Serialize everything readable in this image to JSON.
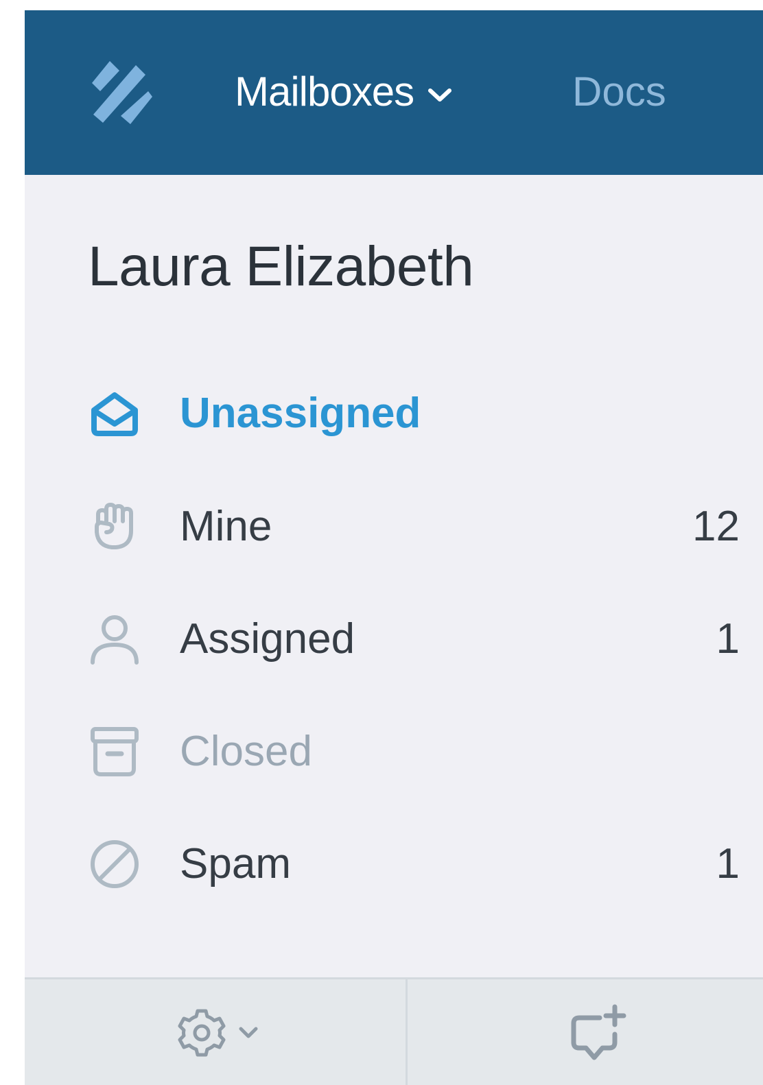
{
  "app": {
    "brand_colors": {
      "topbar": "#1c5b86",
      "logo": "#7fb3de",
      "active": "#2b95d3",
      "muted_icon": "#aebac4",
      "text": "#363d45",
      "muted_text": "#9aa7b3"
    }
  },
  "topbar": {
    "logo_icon": "helpscout-logo-icon",
    "mailboxes_label": "Mailboxes",
    "mailboxes_chevron_icon": "chevron-down-icon",
    "docs_label": "Docs"
  },
  "sidebar": {
    "account_name": "Laura Elizabeth",
    "folders": [
      {
        "label": "Unassigned",
        "count": "",
        "icon": "envelope-open-icon",
        "state": "active"
      },
      {
        "label": "Mine",
        "count": "12",
        "icon": "hand-icon",
        "state": "normal"
      },
      {
        "label": "Assigned",
        "count": "1",
        "icon": "person-icon",
        "state": "normal"
      },
      {
        "label": "Closed",
        "count": "",
        "icon": "archive-box-icon",
        "state": "muted"
      },
      {
        "label": "Spam",
        "count": "1",
        "icon": "ban-icon",
        "state": "normal"
      }
    ]
  },
  "footer": {
    "settings_icon": "gear-icon",
    "settings_chevron_icon": "chevron-down-icon",
    "new_chat_icon": "add-chat-icon"
  }
}
